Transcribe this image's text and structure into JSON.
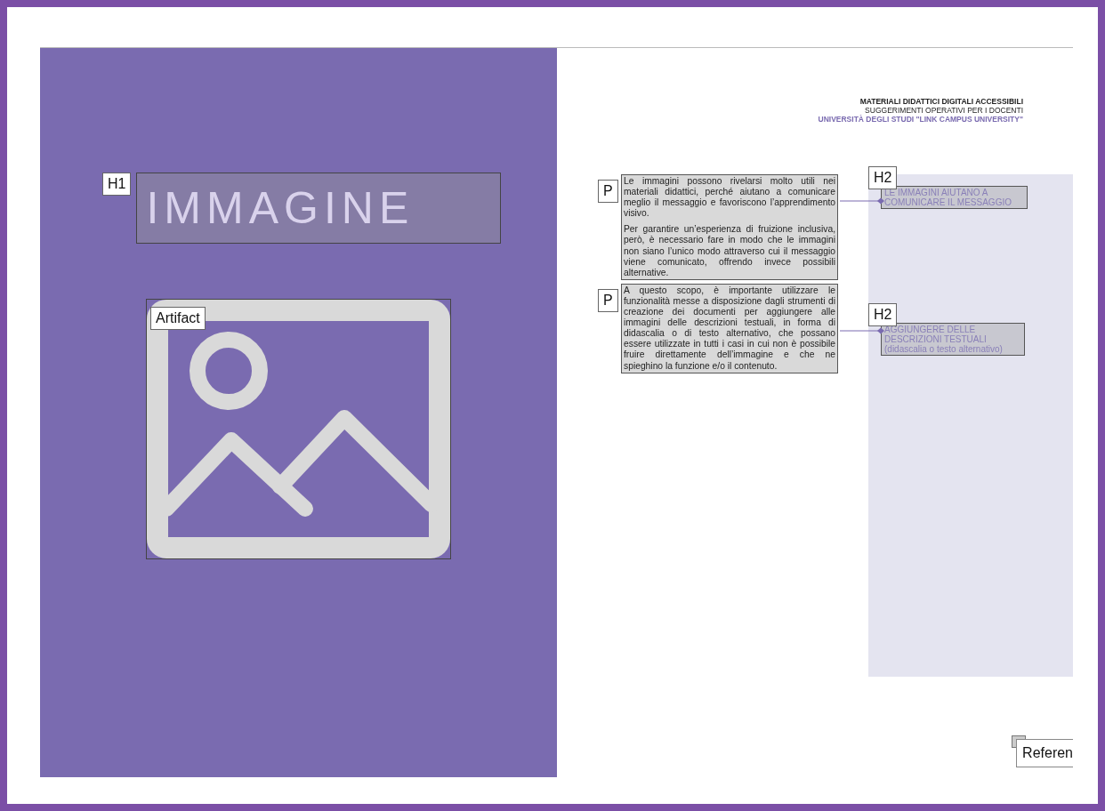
{
  "header": {
    "title": "MATERIALI DIDATTICI DIGITALI ACCESSIBILI",
    "subtitle": "SUGGERIMENTI OPERATIVI PER I DOCENTI",
    "university": "UNIVERSITÀ DEGLI STUDI \"LINK CAMPUS UNIVERSITY\""
  },
  "heading": {
    "tag": "H1",
    "text": "IMMAGINE"
  },
  "artifact": {
    "tag": "Artifact"
  },
  "paragraphs": [
    {
      "tag": "P",
      "texts": [
        "Le immagini possono rivelarsi molto utili nei materiali didattici, perché aiutano a comunicare meglio il messaggio e favoriscono l’apprendimento visivo.",
        "Per garantire un’esperienza di fruizione inclusiva, però, è necessario fare in modo che le immagini non siano l’unico modo attraverso cui il messaggio viene comunicato, offrendo invece possibili alternative."
      ]
    },
    {
      "tag": "P",
      "texts": [
        "A questo scopo, è importante utilizzare le funzionalità messe a disposizione dagli strumenti di creazione dei documenti per aggiungere alle immagini delle descrizioni testuali, in forma di didascalia o di testo alternativo, che possano essere utilizzate in tutti i casi in cui non è possibile fruire direttamente dell’immagine e che ne spieghino la funzione e/o il contenuto."
      ]
    }
  ],
  "side_headings": [
    {
      "tag": "H2",
      "text": "LE IMMAGINI AIUTANO A COMUNICARE IL MESSAGGIO"
    },
    {
      "tag": "H2",
      "text": "AGGIUNGERE DELLE DESCRIZIONI TESTUALI (didascalia o testo alternativo)"
    }
  ],
  "reference": {
    "tag": "Referen"
  }
}
